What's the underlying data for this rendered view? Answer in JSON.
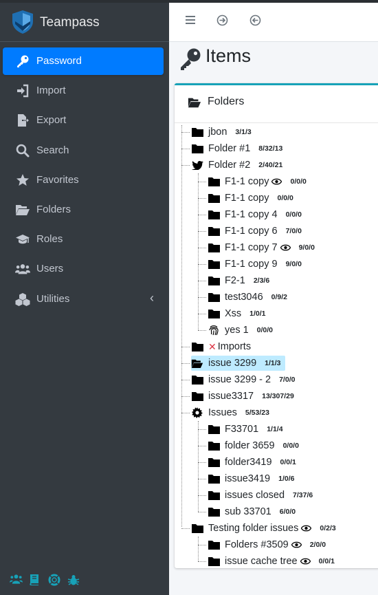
{
  "brand": {
    "name": "Teampass"
  },
  "sidebar": {
    "items": [
      {
        "label": "Password",
        "icon": "key-icon"
      },
      {
        "label": "Import",
        "icon": "sign-in-icon"
      },
      {
        "label": "Export",
        "icon": "file-export-icon"
      },
      {
        "label": "Search",
        "icon": "search-icon"
      },
      {
        "label": "Favorites",
        "icon": "star-icon"
      },
      {
        "label": "Folders",
        "icon": "folder-open-icon"
      },
      {
        "label": "Roles",
        "icon": "graduation-cap-icon"
      },
      {
        "label": "Users",
        "icon": "users-icon"
      },
      {
        "label": "Utilities",
        "icon": "cubes-icon",
        "caret": "‹"
      }
    ]
  },
  "page": {
    "title": "Items"
  },
  "folders_card": {
    "title": "Folders"
  },
  "tree": [
    {
      "name": "jbon",
      "count": "3/1/3"
    },
    {
      "name": "Folder #1",
      "count": "8/32/13"
    },
    {
      "name": "Folder #2",
      "count": "2/40/21"
    },
    {
      "name": "F1-1 copy",
      "count": "0/0/0"
    },
    {
      "name": "F1-1 copy",
      "count": "0/0/0"
    },
    {
      "name": "F1-1 copy 4",
      "count": "0/0/0"
    },
    {
      "name": "F1-1 copy 6",
      "count": "7/0/0"
    },
    {
      "name": "F1-1 copy 7",
      "count": "9/0/0"
    },
    {
      "name": "F1-1 copy 9",
      "count": "9/0/0"
    },
    {
      "name": "F2-1",
      "count": "2/3/6"
    },
    {
      "name": "test3046",
      "count": "0/9/2"
    },
    {
      "name": "Xss",
      "count": "1/0/1"
    },
    {
      "name": "yes 1",
      "count": "0/0/0"
    },
    {
      "name": "Imports",
      "count": "",
      "mark": "✕"
    },
    {
      "name": "issue 3299",
      "count": "1/1/3"
    },
    {
      "name": "issue 3299 - 2",
      "count": "7/0/0"
    },
    {
      "name": "issue3317",
      "count": "13/307/29"
    },
    {
      "name": "Issues",
      "count": "5/53/23"
    },
    {
      "name": "F33701",
      "count": "1/1/4"
    },
    {
      "name": "folder 3659",
      "count": "0/0/0"
    },
    {
      "name": "folder3419",
      "count": "0/0/1"
    },
    {
      "name": "issue3419",
      "count": "1/0/6"
    },
    {
      "name": "issues closed",
      "count": "7/37/6"
    },
    {
      "name": "sub 33701",
      "count": "6/0/0"
    },
    {
      "name": "Testing folder issues",
      "count": "0/2/3"
    },
    {
      "name": "Folders #3509",
      "count": "2/0/0"
    },
    {
      "name": "issue cache tree",
      "count": "0/0/1"
    }
  ]
}
